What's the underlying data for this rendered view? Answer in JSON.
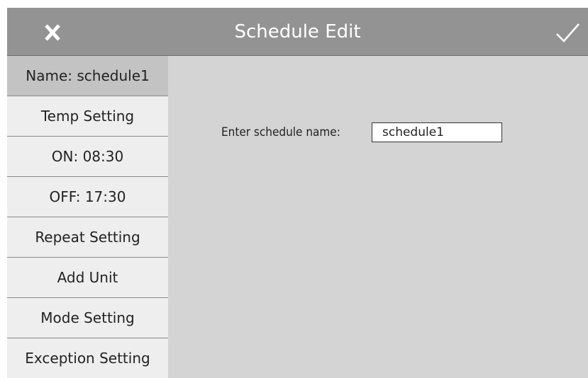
{
  "header": {
    "title": "Schedule Edit",
    "close_icon": "close-icon",
    "confirm_icon": "checkmark-icon",
    "background_color": "#939393"
  },
  "sidebar": {
    "items": [
      {
        "label": "Name: schedule1",
        "active": true
      },
      {
        "label": "Temp Setting",
        "active": false
      },
      {
        "label": "ON: 08:30",
        "active": false
      },
      {
        "label": "OFF: 17:30",
        "active": false
      },
      {
        "label": "Repeat Setting",
        "active": false
      },
      {
        "label": "Add Unit",
        "active": false
      },
      {
        "label": "Mode Setting",
        "active": false
      },
      {
        "label": "Exception Setting",
        "active": false
      }
    ]
  },
  "main": {
    "name_label": "Enter schedule name:",
    "name_value": "schedule1"
  }
}
